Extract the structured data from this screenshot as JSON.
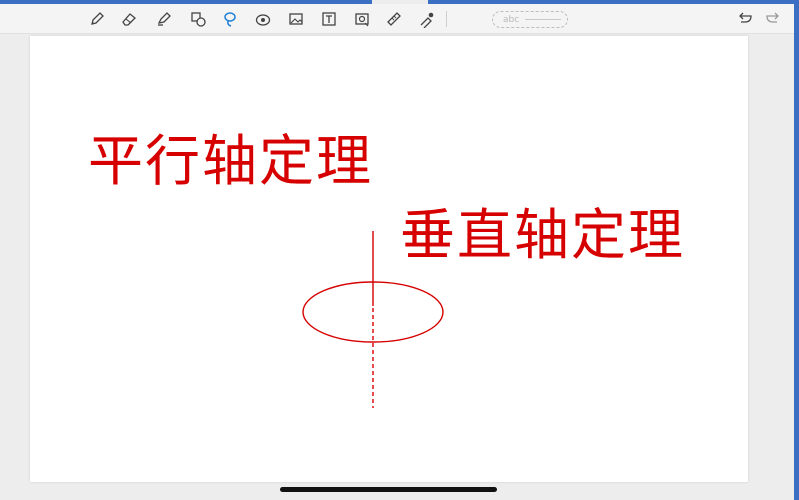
{
  "toolbar": {
    "tools": [
      {
        "name": "pen-icon",
        "active": false
      },
      {
        "name": "eraser-icon",
        "active": false
      },
      {
        "name": "highlighter-icon",
        "active": false
      },
      {
        "name": "shapes-icon",
        "active": false
      },
      {
        "name": "lasso-icon",
        "active": true
      },
      {
        "name": "sticker-icon",
        "active": false
      },
      {
        "name": "image-icon",
        "active": false
      },
      {
        "name": "text-tool-icon",
        "active": false
      },
      {
        "name": "camera-icon",
        "active": false
      },
      {
        "name": "ruler-icon",
        "active": false
      },
      {
        "name": "laser-pointer-icon",
        "active": false
      }
    ],
    "text_box_placeholder": "abc",
    "undo_icon": "undo-icon",
    "redo_icon": "redo-icon"
  },
  "colors": {
    "ink": "#d60000",
    "active_tool": "#1e7fd6",
    "toolbar_icon": "#444444"
  },
  "canvas": {
    "heading_1": "平行轴定理",
    "heading_2": "垂直轴定理"
  }
}
